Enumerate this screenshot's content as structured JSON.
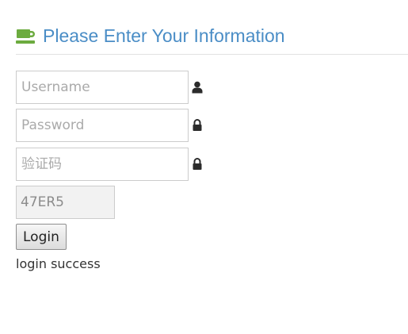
{
  "header": {
    "icon": "coffee-cup-icon",
    "title": "Please Enter Your Information"
  },
  "form": {
    "username": {
      "value": "",
      "placeholder": "Username",
      "icon": "user-icon"
    },
    "password": {
      "value": "",
      "placeholder": "Password",
      "icon": "lock-icon"
    },
    "captcha_input": {
      "value": "",
      "placeholder": "验证码",
      "icon": "lock-icon"
    },
    "captcha_code": "47ER5",
    "login_label": "Login"
  },
  "status": {
    "message": "login success"
  },
  "colors": {
    "title": "#4a8dc6",
    "header_icon": "#6cab3f",
    "field_icon": "#2b2b2b"
  }
}
